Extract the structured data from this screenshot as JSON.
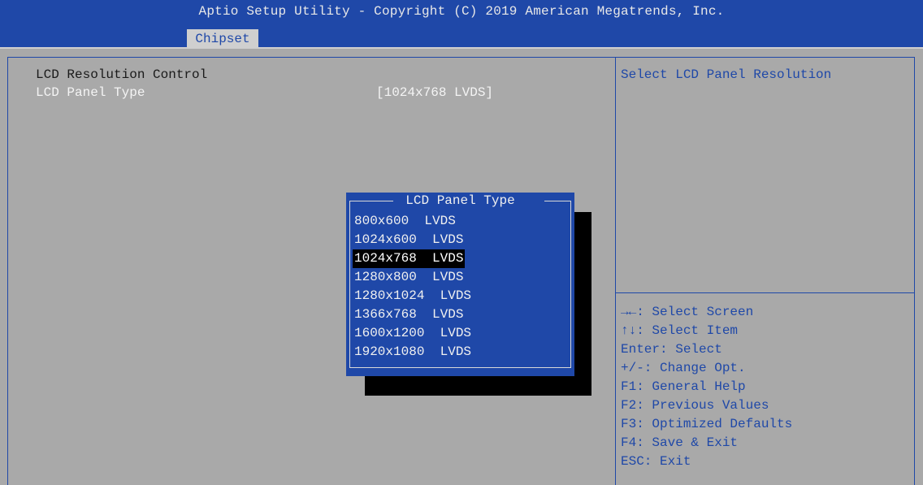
{
  "header": {
    "title": "Aptio Setup Utility - Copyright (C) 2019 American Megatrends, Inc.",
    "active_tab": "Chipset"
  },
  "main": {
    "section_title": "LCD Resolution Control",
    "setting": {
      "label": "LCD Panel Type",
      "value": "[1024x768  LVDS]"
    }
  },
  "help": {
    "description": "Select LCD Panel Resolution"
  },
  "keys": [
    "→←: Select Screen",
    "↑↓: Select Item",
    "Enter: Select",
    "+/-: Change Opt.",
    "F1: General Help",
    "F2: Previous Values",
    "F3: Optimized Defaults",
    "F4: Save & Exit",
    "ESC: Exit"
  ],
  "popup": {
    "title": "LCD Panel Type",
    "selected_index": 2,
    "options": [
      "800x600  LVDS",
      "1024x600  LVDS",
      "1024x768  LVDS",
      "1280x800  LVDS",
      "1280x1024  LVDS",
      "1366x768  LVDS",
      "1600x1200  LVDS",
      "1920x1080  LVDS"
    ]
  },
  "colors": {
    "background": "#a9a9a9",
    "accent_blue": "#1f48a8",
    "highlight_text": "#f4f4f4",
    "selection_bg": "#000000"
  }
}
